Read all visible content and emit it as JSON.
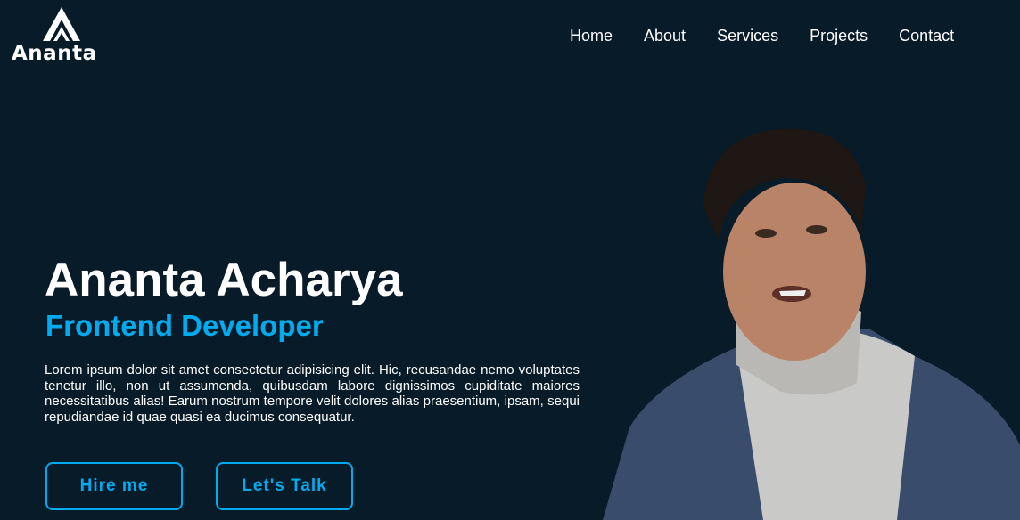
{
  "logo": {
    "text": "Ananta"
  },
  "nav": {
    "items": [
      "Home",
      "About",
      "Services",
      "Projects",
      "Contact"
    ]
  },
  "hero": {
    "name": "Ananta Acharya",
    "role": "Frontend Developer",
    "description": "Lorem ipsum dolor sit amet consectetur adipisicing elit. Hic, recusandae nemo voluptates tenetur illo, non ut assumenda, quibusdam labore dignissimos cupiditate maiores necessitatibus alias! Earum nostrum tempore velit dolores alias praesentium, ipsam, sequi repudiandae id quae quasi ea ducimus consequatur.",
    "buttons": {
      "hire": "Hire me",
      "talk": "Let's Talk"
    }
  },
  "colors": {
    "background": "#081b29",
    "accent": "#00abf0"
  }
}
